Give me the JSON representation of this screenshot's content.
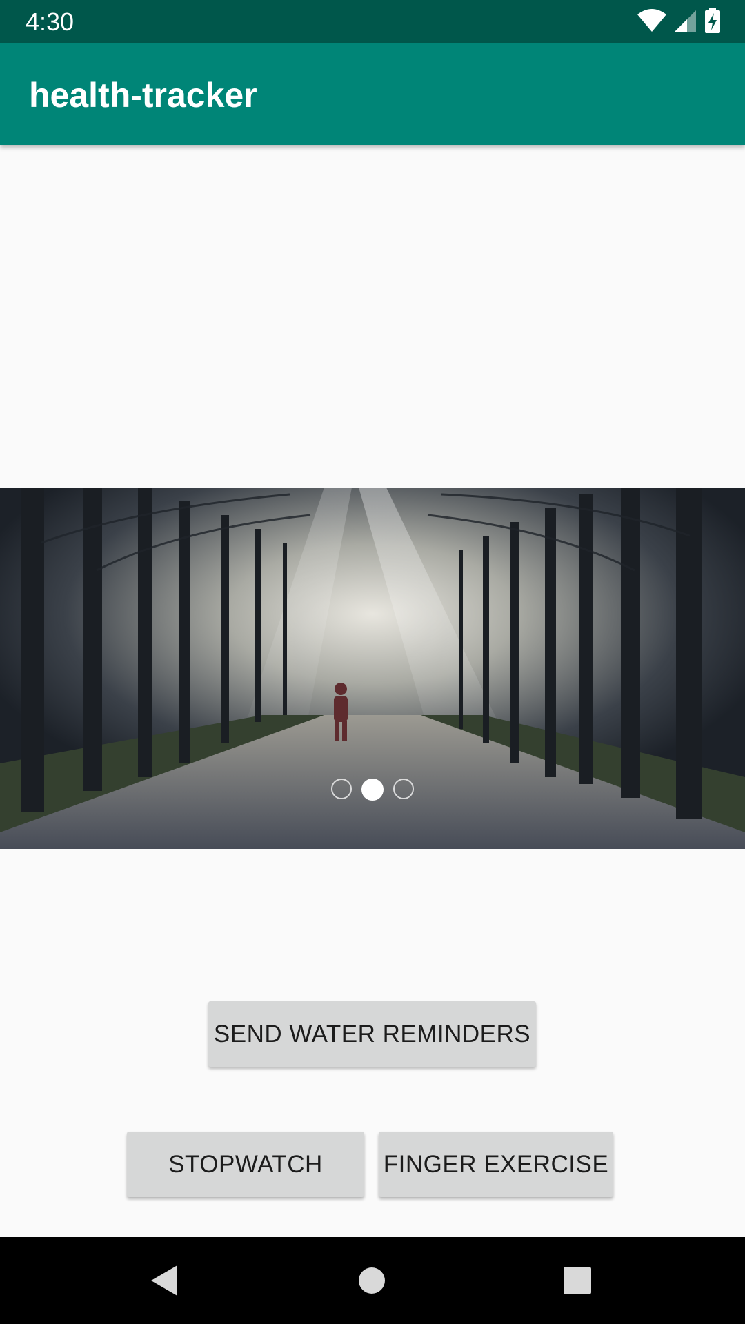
{
  "status_bar": {
    "time": "4:30",
    "icons": [
      "wifi-icon",
      "cellular-signal-icon",
      "battery-charging-icon"
    ]
  },
  "app_bar": {
    "title": "health-tracker"
  },
  "carousel": {
    "image_description_icon": "forest-path-runner-image",
    "slide_count": 3,
    "active_slide": 2
  },
  "buttons": {
    "water": "SEND WATER REMINDERS",
    "stopwatch": "STOPWATCH",
    "finger": "FINGER EXERCISE"
  },
  "nav_bar": {
    "icons": [
      "back-icon",
      "home-icon",
      "recents-icon"
    ]
  },
  "colors": {
    "status_bar": "#00574b",
    "app_bar": "#008577",
    "background": "#fafafa",
    "button": "#d6d7d7"
  }
}
